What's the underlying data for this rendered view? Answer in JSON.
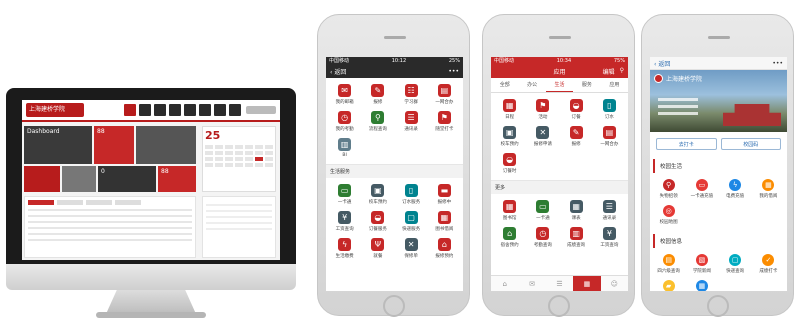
{
  "desktop": {
    "logo_text": "上海建桥学院",
    "tile_dashboard": "Dashboard",
    "tile_count_a": "88",
    "tile_count_b": "0",
    "tile_unread": "88",
    "calendar_day": "25"
  },
  "phone1": {
    "carrier": "中国移动",
    "time": "10:12",
    "battery": "25%",
    "back_label": "返回",
    "more_icon": "•••",
    "apps_top": [
      {
        "label": "我的邮箱",
        "icon": "mail-icon",
        "color": "#c62828"
      },
      {
        "label": "报修",
        "icon": "wrench-icon",
        "color": "#c62828"
      },
      {
        "label": "学习群",
        "icon": "group-icon",
        "color": "#c62828"
      },
      {
        "label": "一网合办",
        "icon": "clip-icon",
        "color": "#c62828"
      },
      {
        "label": "我的考勤",
        "icon": "clock-icon",
        "color": "#c62828"
      },
      {
        "label": "流程查询",
        "icon": "search-icon",
        "color": "#2e7d32"
      },
      {
        "label": "通讯录",
        "icon": "contacts-icon",
        "color": "#c62828"
      },
      {
        "label": "随堂打卡",
        "icon": "flag-icon",
        "color": "#c62828"
      },
      {
        "label": "BI",
        "icon": "chart-icon",
        "color": "#607d8b"
      }
    ],
    "section_title": "生活服务",
    "apps_life": [
      {
        "label": "一卡通",
        "icon": "card-icon",
        "color": "#2e7d32"
      },
      {
        "label": "校车预约",
        "icon": "bus-icon",
        "color": "#455a64"
      },
      {
        "label": "订水服务",
        "icon": "bottle-icon",
        "color": "#00838f"
      },
      {
        "label": "报修中",
        "icon": "bed-icon",
        "color": "#c62828"
      },
      {
        "label": "工资查询",
        "icon": "money-icon",
        "color": "#455a64"
      },
      {
        "label": "订餐服务",
        "icon": "food-icon",
        "color": "#c62828"
      },
      {
        "label": "快递服务",
        "icon": "box-icon",
        "color": "#00838f"
      },
      {
        "label": "图书借阅",
        "icon": "book-icon",
        "color": "#c62828"
      },
      {
        "label": "生活缴费",
        "icon": "bolt-icon",
        "color": "#c62828"
      },
      {
        "label": "就餐",
        "icon": "utensils-icon",
        "color": "#c62828"
      },
      {
        "label": "保修单",
        "icon": "tool-icon",
        "color": "#455a64"
      },
      {
        "label": "报修预约",
        "icon": "home-icon",
        "color": "#c62828"
      }
    ]
  },
  "phone2": {
    "carrier": "中国移动",
    "time": "10:34",
    "battery": "75%",
    "title": "应用",
    "edit_label": "编辑",
    "tabs": [
      "全部",
      "办公",
      "生活",
      "服务",
      "应用"
    ],
    "apps_top": [
      {
        "label": "日程",
        "icon": "calendar-icon",
        "color": "#c62828"
      },
      {
        "label": "活动",
        "icon": "flag-icon",
        "color": "#c62828"
      },
      {
        "label": "订餐",
        "icon": "food-icon",
        "color": "#c62828"
      },
      {
        "label": "订水",
        "icon": "bottle-icon",
        "color": "#00838f"
      },
      {
        "label": "校车预约",
        "icon": "bus-icon",
        "color": "#455a64"
      },
      {
        "label": "报修申请",
        "icon": "tool-icon",
        "color": "#455a64"
      },
      {
        "label": "报修",
        "icon": "wrench-icon",
        "color": "#c62828"
      },
      {
        "label": "一网合办",
        "icon": "clip-icon",
        "color": "#c62828"
      },
      {
        "label": "订餐时",
        "icon": "food-icon",
        "color": "#c62828"
      }
    ],
    "section_title": "更多",
    "apps_more": [
      {
        "label": "图书馆",
        "icon": "book-icon",
        "color": "#c62828"
      },
      {
        "label": "一卡通",
        "icon": "card-icon",
        "color": "#2e7d32"
      },
      {
        "label": "课表",
        "icon": "grid-icon",
        "color": "#455a64"
      },
      {
        "label": "通讯录",
        "icon": "contacts-icon",
        "color": "#455a64"
      },
      {
        "label": "宿舍预约",
        "icon": "home-icon",
        "color": "#2e7d32"
      },
      {
        "label": "考勤查询",
        "icon": "clock-icon",
        "color": "#c62828"
      },
      {
        "label": "成绩查询",
        "icon": "chart-icon",
        "color": "#c62828"
      },
      {
        "label": "工资查询",
        "icon": "money-icon",
        "color": "#455a64"
      }
    ]
  },
  "phone3": {
    "back_label": "返回",
    "more_icon": "•••",
    "school_name": "上海建桥学院",
    "btn_left": "去打卡",
    "btn_right": "校园码",
    "section1": "校园生活",
    "apps1": [
      {
        "label": "失物招领",
        "icon": "search-icon",
        "color": "#c62828"
      },
      {
        "label": "一卡通充值",
        "icon": "card-icon",
        "color": "#e53935"
      },
      {
        "label": "电费充值",
        "icon": "bolt-icon",
        "color": "#1e88e5"
      },
      {
        "label": "我的借阅",
        "icon": "book-icon",
        "color": "#fb8c00"
      },
      {
        "label": "校园地图",
        "icon": "map-icon",
        "color": "#e53935"
      }
    ],
    "section2": "校园信息",
    "apps2": [
      {
        "label": "四六级查询",
        "icon": "doc-icon",
        "color": "#fb8c00"
      },
      {
        "label": "学院新闻",
        "icon": "news-icon",
        "color": "#e53935"
      },
      {
        "label": "快递查询",
        "icon": "box-icon",
        "color": "#00acc1"
      },
      {
        "label": "成绩打卡",
        "icon": "check-icon",
        "color": "#fb8c00"
      },
      {
        "label": "就业信息",
        "icon": "briefcase-icon",
        "color": "#fbc02d"
      },
      {
        "label": "校历",
        "icon": "calendar-icon",
        "color": "#1e88e5"
      }
    ]
  }
}
